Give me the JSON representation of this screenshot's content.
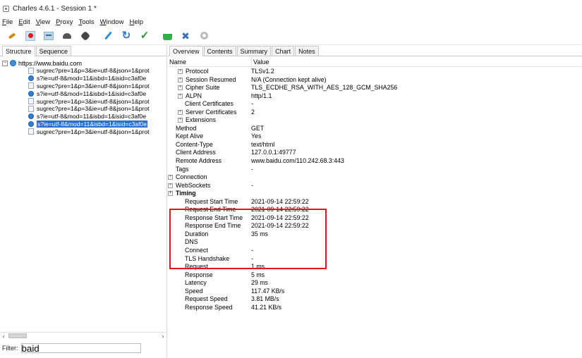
{
  "window": {
    "title": "Charles 4.6.1 - Session 1 *"
  },
  "menu": [
    {
      "accel": "F",
      "rest": "ile"
    },
    {
      "accel": "E",
      "rest": "dit"
    },
    {
      "accel": "V",
      "rest": "iew"
    },
    {
      "accel": "P",
      "rest": "roxy"
    },
    {
      "accel": "T",
      "rest": "ools"
    },
    {
      "accel": "W",
      "rest": "indow"
    },
    {
      "accel": "H",
      "rest": "elp"
    }
  ],
  "toolbar": {
    "icons": [
      "broom-icon",
      "record-icon",
      "throttle-icon",
      "turtle-icon",
      "breakpoint-icon",
      "pen-icon",
      "refresh-icon",
      "check-icon",
      "basket-icon",
      "tools-icon",
      "settings-icon"
    ]
  },
  "left": {
    "tabs": [
      "Structure",
      "Sequence"
    ],
    "host": "https://www.baidu.com",
    "requests": [
      {
        "type": "doc",
        "label": "sugrec?pre=1&p=3&ie=utf-8&json=1&prot"
      },
      {
        "type": "dot",
        "label": "s?ie=utf-8&mod=11&isbd=1&isid=c3af0e"
      },
      {
        "type": "doc",
        "label": "sugrec?pre=1&p=3&ie=utf-8&json=1&prot"
      },
      {
        "type": "dot",
        "label": "s?ie=utf-8&mod=11&isbd=1&isid=c3af0e"
      },
      {
        "type": "doc",
        "label": "sugrec?pre=1&p=3&ie=utf-8&json=1&prot"
      },
      {
        "type": "doc",
        "label": "sugrec?pre=1&p=3&ie=utf-8&json=1&prot"
      },
      {
        "type": "dot",
        "label": "s?ie=utf-8&mod=11&isbd=1&isid=c3af0e"
      },
      {
        "type": "dot",
        "label": "s?ie=utf-8&mod=11&isbd=1&isid=c3af0e",
        "selected": true
      },
      {
        "type": "doc",
        "label": "sugrec?pre=1&p=3&ie=utf-8&json=1&prot"
      }
    ],
    "filter_label": "Filter:",
    "filter_value": "baid"
  },
  "right": {
    "tabs": [
      "Overview",
      "Contents",
      "Summary",
      "Chart",
      "Notes"
    ],
    "active_tab": "Overview",
    "columns": {
      "name": "Name",
      "value": "Value"
    },
    "rows": [
      {
        "indent": "l2",
        "expand": true,
        "name": "Protocol",
        "value": "TLSv1.2"
      },
      {
        "indent": "l2",
        "expand": true,
        "name": "Session Resumed",
        "value": "N/A (Connection kept alive)"
      },
      {
        "indent": "l2",
        "expand": true,
        "name": "Cipher Suite",
        "value": "TLS_ECDHE_RSA_WITH_AES_128_GCM_SHA256"
      },
      {
        "indent": "l2",
        "expand": true,
        "name": "ALPN",
        "value": "http/1.1"
      },
      {
        "indent": "l2n",
        "expand": false,
        "name": "Client Certificates",
        "value": "-"
      },
      {
        "indent": "l2",
        "expand": true,
        "name": "Server Certificates",
        "value": "2"
      },
      {
        "indent": "l2",
        "expand": true,
        "name": "Extensions",
        "value": ""
      },
      {
        "indent": "l1",
        "expand": false,
        "name": "Method",
        "value": "GET"
      },
      {
        "indent": "l1",
        "expand": false,
        "name": "Kept Alive",
        "value": "Yes"
      },
      {
        "indent": "l1",
        "expand": false,
        "name": "Content-Type",
        "value": "text/html"
      },
      {
        "indent": "l1",
        "expand": false,
        "name": "Client Address",
        "value": "127.0.0.1:49777"
      },
      {
        "indent": "l1",
        "expand": false,
        "name": "Remote Address",
        "value": "www.baidu.com/110.242.68.3:443"
      },
      {
        "indent": "l1",
        "expand": false,
        "name": "Tags",
        "value": "-"
      },
      {
        "indent": "l0",
        "expand": true,
        "name": "Connection",
        "value": ""
      },
      {
        "indent": "l0",
        "expand": true,
        "name": "WebSockets",
        "value": "-"
      },
      {
        "indent": "l0",
        "expand": true,
        "bold": true,
        "name": "Timing",
        "value": ""
      },
      {
        "indent": "l2n",
        "expand": false,
        "name": "Request Start Time",
        "value": "2021-09-14 22:59:22"
      },
      {
        "indent": "l2n",
        "expand": false,
        "name": "Request End Time",
        "value": "2021-09-14 22:59:22"
      },
      {
        "indent": "l2n",
        "expand": false,
        "name": "Response Start Time",
        "value": "2021-09-14 22:59:22"
      },
      {
        "indent": "l2n",
        "expand": false,
        "name": "Response End Time",
        "value": "2021-09-14 22:59:22"
      },
      {
        "indent": "l2n",
        "expand": false,
        "name": "Duration",
        "value": "35 ms"
      },
      {
        "indent": "l2n",
        "expand": false,
        "name": "DNS",
        "value": ""
      },
      {
        "indent": "l2n",
        "expand": false,
        "name": "Connect",
        "value": "-"
      },
      {
        "indent": "l2n",
        "expand": false,
        "name": "TLS Handshake",
        "value": "-"
      },
      {
        "indent": "l2n",
        "expand": false,
        "name": "Request",
        "value": "1 ms"
      },
      {
        "indent": "l2n",
        "expand": false,
        "name": "Response",
        "value": "5 ms"
      },
      {
        "indent": "l2n",
        "expand": false,
        "name": "Latency",
        "value": "29 ms"
      },
      {
        "indent": "l2n",
        "expand": false,
        "name": "Speed",
        "value": "117.47 KB/s"
      },
      {
        "indent": "l2n",
        "expand": false,
        "name": "Request Speed",
        "value": "3.81 MB/s"
      },
      {
        "indent": "l2n",
        "expand": false,
        "name": "Response Speed",
        "value": "41.21 KB/s"
      }
    ]
  },
  "annotation": {
    "color": "#e0161e"
  }
}
